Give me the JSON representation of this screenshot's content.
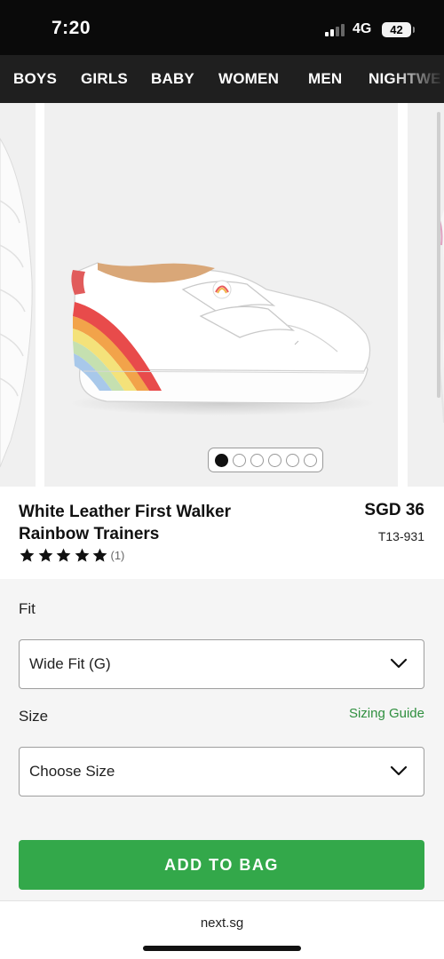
{
  "status_bar": {
    "time": "7:20",
    "network": "4G",
    "battery": "42"
  },
  "nav": {
    "items": [
      "BOYS",
      "GIRLS",
      "BABY",
      "WOMEN",
      "MEN",
      "NIGHTWE"
    ]
  },
  "gallery": {
    "image_count": 6,
    "active_index": 0
  },
  "product": {
    "title": "White Leather First Walker Rainbow Trainers",
    "price": "SGD 36",
    "code": "T13-931",
    "rating_stars": 5,
    "review_count": "(1)"
  },
  "options": {
    "fit_label": "Fit",
    "fit_value": "Wide Fit (G)",
    "size_label": "Size",
    "size_value": "Choose Size",
    "sizing_guide": "Sizing Guide"
  },
  "cta": {
    "add_to_bag": "ADD TO BAG"
  },
  "browser": {
    "url": "next.sg"
  },
  "colors": {
    "accent_green": "#33a84a",
    "link_green": "#2f8f3f",
    "nav_bg": "#1f1f1f"
  }
}
